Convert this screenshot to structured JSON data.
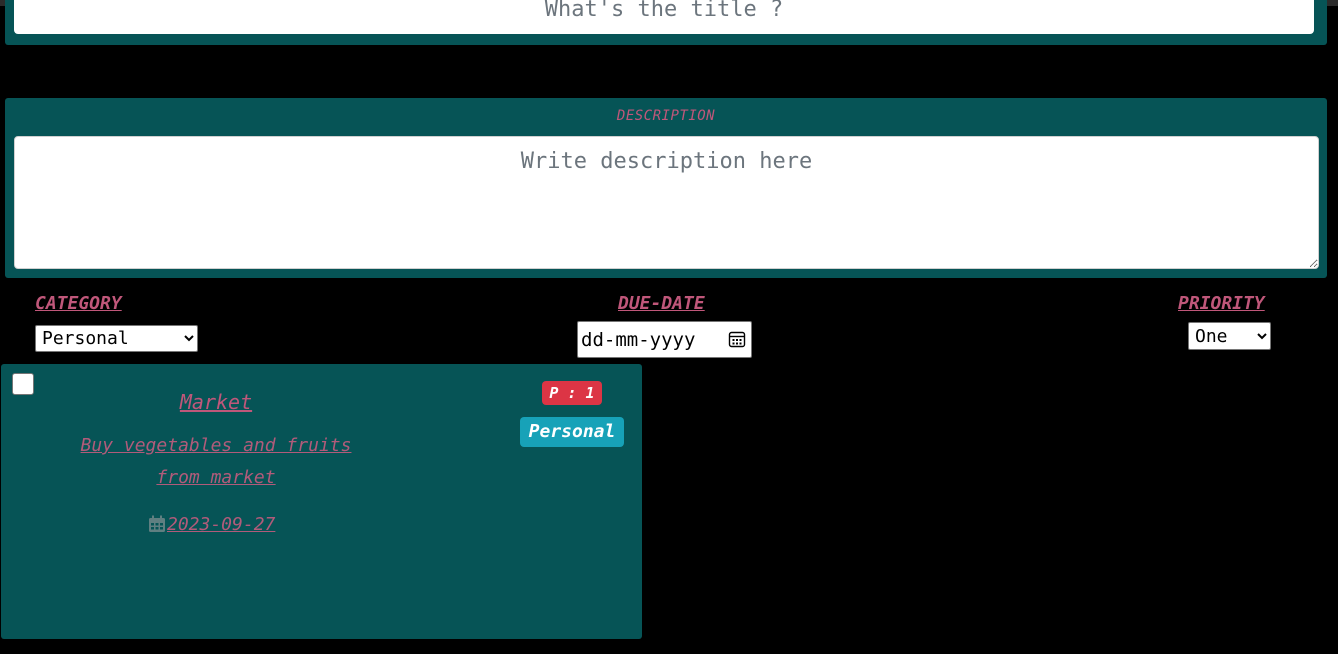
{
  "form": {
    "title_placeholder": "What's the title ?",
    "description_label": "DESCRIPTION",
    "description_placeholder": "Write description here",
    "category_label": "CATEGORY",
    "category_selected": "Personal",
    "duedate_label": "DUE-DATE",
    "duedate_placeholder": "dd-mm-yyyy",
    "priority_label": "PRIORITY",
    "priority_selected": "One"
  },
  "tasks": [
    {
      "title": "Market",
      "description": "Buy vegetables and fruits from market",
      "due_date": "2023-09-27",
      "priority_badge": "P : 1",
      "category_badge": "Personal",
      "completed": false
    }
  ],
  "colors": {
    "background": "#000000",
    "panel": "#065456",
    "label_pink": "#c0577a",
    "priority_badge": "#dc3545",
    "category_badge": "#17a2b8"
  }
}
